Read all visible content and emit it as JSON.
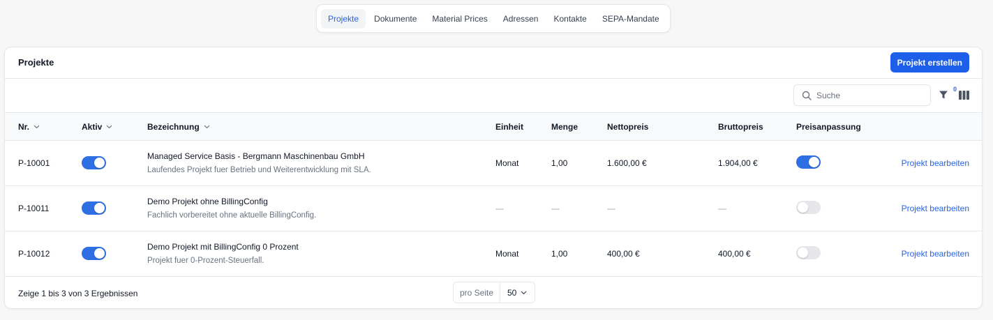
{
  "tabs": [
    {
      "label": "Projekte",
      "active": true
    },
    {
      "label": "Dokumente",
      "active": false
    },
    {
      "label": "Material Prices",
      "active": false
    },
    {
      "label": "Adressen",
      "active": false
    },
    {
      "label": "Kontakte",
      "active": false
    },
    {
      "label": "SEPA-Mandate",
      "active": false
    }
  ],
  "card": {
    "title": "Projekte",
    "create_button": "Projekt erstellen"
  },
  "toolbar": {
    "search_placeholder": "Suche",
    "search_value": "",
    "filter_count": "0",
    "icons": [
      "search-icon",
      "filter-icon",
      "columns-icon"
    ]
  },
  "table": {
    "headers": {
      "nr": "Nr.",
      "aktiv": "Aktiv",
      "bezeichnung": "Bezeichnung",
      "einheit": "Einheit",
      "menge": "Menge",
      "nettopreis": "Nettopreis",
      "bruttopreis": "Bruttopreis",
      "preisanpassung": "Preisanpassung"
    },
    "rows": [
      {
        "nr": "P-10001",
        "aktiv": true,
        "title": "Managed Service Basis - Bergmann Maschinenbau GmbH",
        "subtitle": "Laufendes Projekt fuer Betrieb und Weiterentwicklung mit SLA.",
        "einheit": "Monat",
        "menge": "1,00",
        "nettopreis": "1.600,00 €",
        "bruttopreis": "1.904,00 €",
        "preisanpassung": true,
        "action": "Projekt bearbeiten"
      },
      {
        "nr": "P-10011",
        "aktiv": true,
        "title": "Demo Projekt ohne BillingConfig",
        "subtitle": "Fachlich vorbereitet ohne aktuelle BillingConfig.",
        "einheit": "—",
        "menge": "—",
        "nettopreis": "—",
        "bruttopreis": "—",
        "preisanpassung": false,
        "action": "Projekt bearbeiten"
      },
      {
        "nr": "P-10012",
        "aktiv": true,
        "title": "Demo Projekt mit BillingConfig 0 Prozent",
        "subtitle": "Projekt fuer 0-Prozent-Steuerfall.",
        "einheit": "Monat",
        "menge": "1,00",
        "nettopreis": "400,00 €",
        "bruttopreis": "400,00 €",
        "preisanpassung": false,
        "action": "Projekt bearbeiten"
      }
    ]
  },
  "footer": {
    "summary": "Zeige 1 bis 3 von 3 Ergebnissen",
    "per_page_label": "pro Seite",
    "per_page_value": "50"
  },
  "colors": {
    "accent": "#1d5fe8",
    "toggle_on": "#2f6fe4",
    "toggle_off": "#e5e7eb",
    "link": "#2563eb"
  }
}
